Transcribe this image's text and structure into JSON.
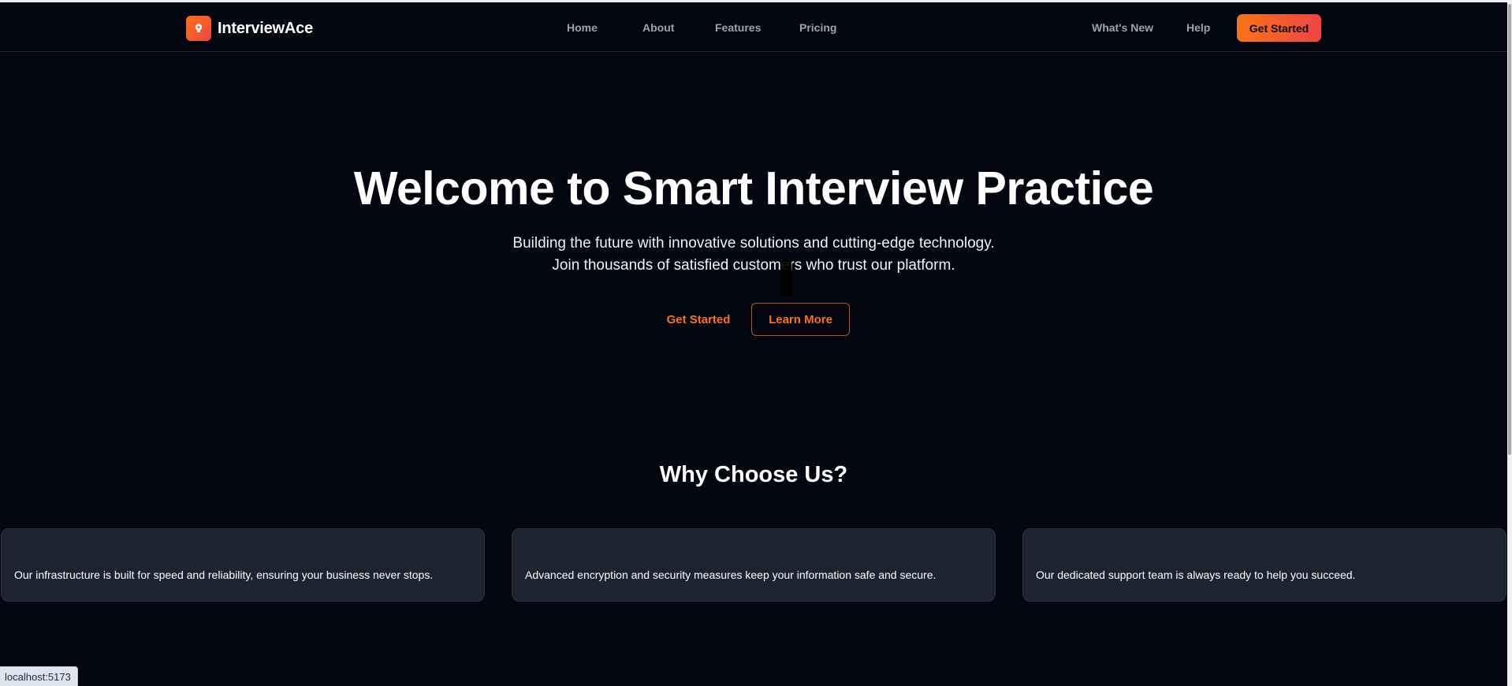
{
  "navbar": {
    "brand_name": "InterviewAce",
    "links": [
      {
        "label": "Home"
      },
      {
        "label": "About"
      },
      {
        "label": "Features"
      },
      {
        "label": "Pricing"
      }
    ],
    "right_links": [
      {
        "label": "What's New"
      },
      {
        "label": "Help"
      }
    ],
    "cta_label": "Get Started"
  },
  "hero": {
    "title": "Welcome to Smart Interview Practice",
    "subtitle_line1": "Building the future with innovative solutions and cutting-edge technology.",
    "subtitle_line2": "Join thousands of satisfied customers who trust our platform.",
    "primary_button": "Get Started",
    "secondary_button": "Learn More"
  },
  "features": {
    "title": "Why Choose Us?",
    "cards": [
      {
        "text": "Our infrastructure is built for speed and reliability, ensuring your business never stops."
      },
      {
        "text": "Advanced encryption and security measures keep your information safe and secure."
      },
      {
        "text": "Our dedicated support team is always ready to help you succeed."
      }
    ]
  },
  "status_bar": {
    "url": "localhost:5173"
  },
  "colors": {
    "background": "#03060e",
    "accent": "#f97316",
    "accent_end": "#ef4444",
    "card_bg": "#1c2331",
    "nav_text": "#9aa3b2"
  },
  "icons": {
    "brand_logo": "lightbulb-icon"
  }
}
